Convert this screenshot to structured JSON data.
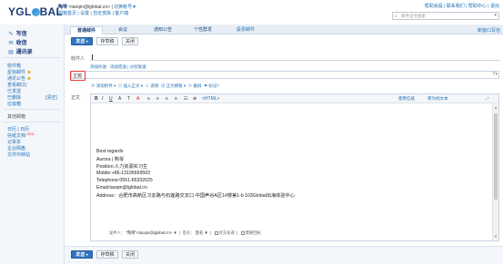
{
  "header": {
    "logo": "YGLOBAL",
    "user_name": "陶琴",
    "user_email": "<taoqin@lglobal.cn>",
    "switch_account": "切换帐号▼",
    "links": [
      "邮箱首页",
      "设置",
      "自定皮肤",
      "客户端"
    ],
    "top_links": [
      "帮助会提",
      "联系我们",
      "帮助中心",
      "退出"
    ],
    "search_placeholder": "邮件全文搜索"
  },
  "sidebar": {
    "main": [
      {
        "icon": "write",
        "label": "写信"
      },
      {
        "icon": "inbox",
        "label": "收信"
      },
      {
        "icon": "contacts",
        "label": "通讯录"
      }
    ],
    "folders": [
      {
        "label": "收件箱",
        "star": false
      },
      {
        "label": "星标邮件",
        "star": true
      },
      {
        "label": "通讯公告",
        "star": true
      },
      {
        "label": "查看邮(3)",
        "star": false
      },
      {
        "label": "已发送",
        "star": false
      },
      {
        "label": "已删除",
        "star": false,
        "right": "[清空]"
      },
      {
        "label": "垃圾箱",
        "star": false
      }
    ],
    "other_title": "其他邮箱",
    "others": [
      {
        "label": "日历 | 日历",
        "badge": ""
      },
      {
        "label": "信纸文档",
        "badge": "NEW"
      },
      {
        "label": "记事本",
        "badge": ""
      },
      {
        "label": "企业网盘",
        "badge": ""
      },
      {
        "label": "文件中转站",
        "badge": ""
      }
    ]
  },
  "tabs": [
    {
      "label": "普通邮件",
      "active": true
    },
    {
      "label": "会议",
      "active": false
    },
    {
      "label": "通知公告",
      "active": false
    },
    {
      "label": "个性群发",
      "active": false
    },
    {
      "label": "投票邮件",
      "active": false
    }
  ],
  "tab_right": "新窗口写信",
  "toolbar": {
    "send": "发送",
    "save_draft": "存草稿",
    "close": "关闭"
  },
  "form": {
    "to_label": "收件人",
    "to_value": "",
    "add_links": "添加抄送 - 添加密送 | 分别发送",
    "subject_label": "主题",
    "subject_value": "",
    "attach_row": [
      "添加附件 ▾",
      "插入正文 ▾",
      "表情",
      "正文模板 ▾",
      "截屏",
      "标记?"
    ],
    "body_label": "正文"
  },
  "editor": {
    "toolbar": [
      "B",
      "I",
      "U",
      "A",
      "T",
      "A",
      "≡",
      "≡",
      "≡",
      "≡",
      "☷",
      "⊕",
      "<HTML>"
    ],
    "right_links": [
      "使用信纸",
      "转为纯文本"
    ],
    "signature": [
      "Best regards",
      "Aurora | 陶琴",
      "Position:人力资源实习生",
      "Mobile:+86-13195699503",
      "Telephone:0551-65332025",
      "Email:taoqin@lglobal.cn",
      "Address：合肥市高新区习友路与石莲路交叉口 中国声谷A区1#楼第1-b 103Global出海体验中心"
    ]
  },
  "sender": {
    "from_label": "发件人：",
    "from_value": "\"陶琴\"<taoqin@lglobal.cn> ▼",
    "sign_label": "签名",
    "sign_value": "签名 ▼",
    "options": [
      "优先投递",
      "需要回执"
    ]
  },
  "bottom_toolbar": {
    "send": "发送",
    "save_draft": "存草稿",
    "close": "关闭"
  },
  "colors": {
    "accent": "#2f74c0",
    "highlight": "#e53935",
    "link": "#1f6fb5"
  }
}
